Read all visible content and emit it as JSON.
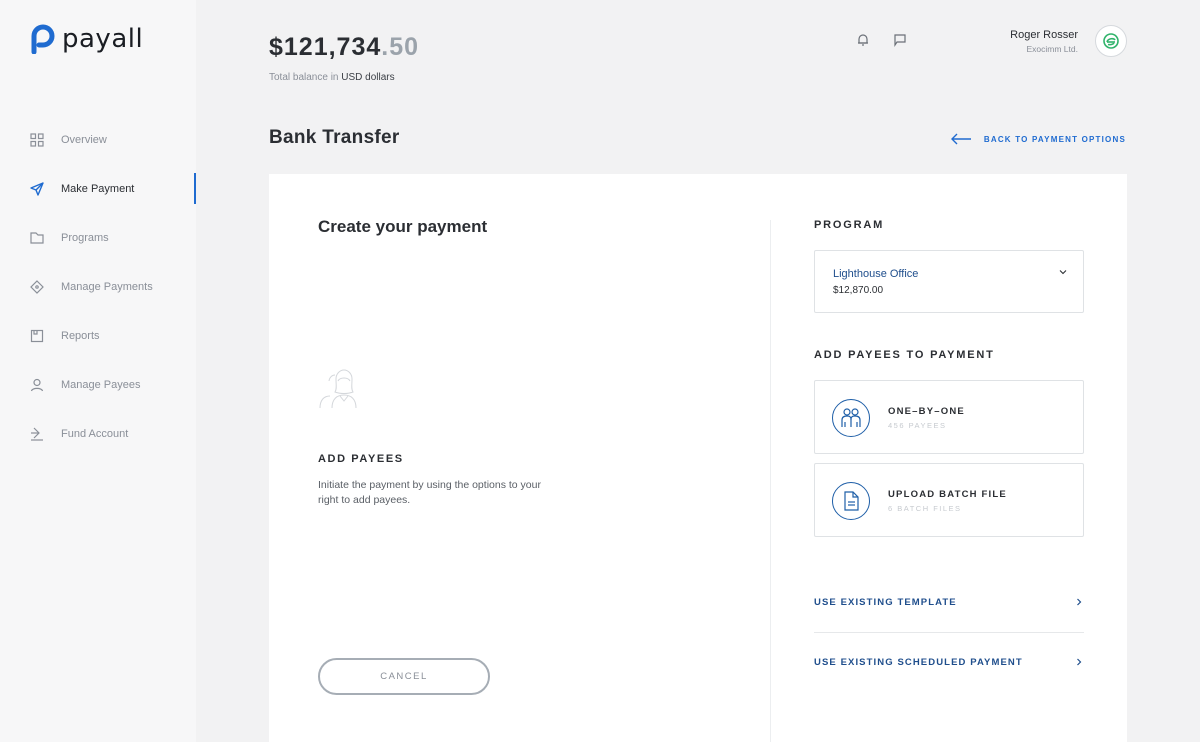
{
  "brand": {
    "name": "payall",
    "accent": "#1f6bd0"
  },
  "sidebar": {
    "items": [
      {
        "label": "Overview",
        "icon": "grid-icon",
        "active": false
      },
      {
        "label": "Make Payment",
        "icon": "paper-plane-icon",
        "active": true
      },
      {
        "label": "Programs",
        "icon": "folder-icon",
        "active": false
      },
      {
        "label": "Manage Payments",
        "icon": "tag-icon",
        "active": false
      },
      {
        "label": "Reports",
        "icon": "report-icon",
        "active": false
      },
      {
        "label": "Manage Payees",
        "icon": "user-icon",
        "active": false
      },
      {
        "label": "Fund Account",
        "icon": "download-icon",
        "active": false
      }
    ]
  },
  "header": {
    "balance_main": "$121,734",
    "balance_cents": ".50",
    "caption_prefix": "Total balance in",
    "caption_currency": "USD dollars",
    "user_name": "Roger Rosser",
    "user_company": "Exocimm Ltd."
  },
  "page": {
    "title": "Bank Transfer",
    "back_label": "BACK TO PAYMENT OPTIONS"
  },
  "left_panel": {
    "title": "Create your payment",
    "add_payees_title": "ADD PAYEES",
    "add_payees_desc": "Initiate the payment by using the options to your right to add payees.",
    "cancel_label": "CANCEL"
  },
  "right_panel": {
    "program_label": "PROGRAM",
    "program": {
      "name": "Lighthouse Office",
      "amount": "$12,870.00"
    },
    "add_payees_label": "ADD PAYEES TO PAYMENT",
    "options": [
      {
        "title": "ONE–BY–ONE",
        "subtitle": "456 PAYEES",
        "icon": "people-icon"
      },
      {
        "title": "UPLOAD BATCH FILE",
        "subtitle": "6 BATCH FILES",
        "icon": "document-icon"
      }
    ],
    "links": [
      {
        "label": "USE EXISTING TEMPLATE"
      },
      {
        "label": "USE EXISTING SCHEDULED PAYMENT"
      }
    ]
  }
}
